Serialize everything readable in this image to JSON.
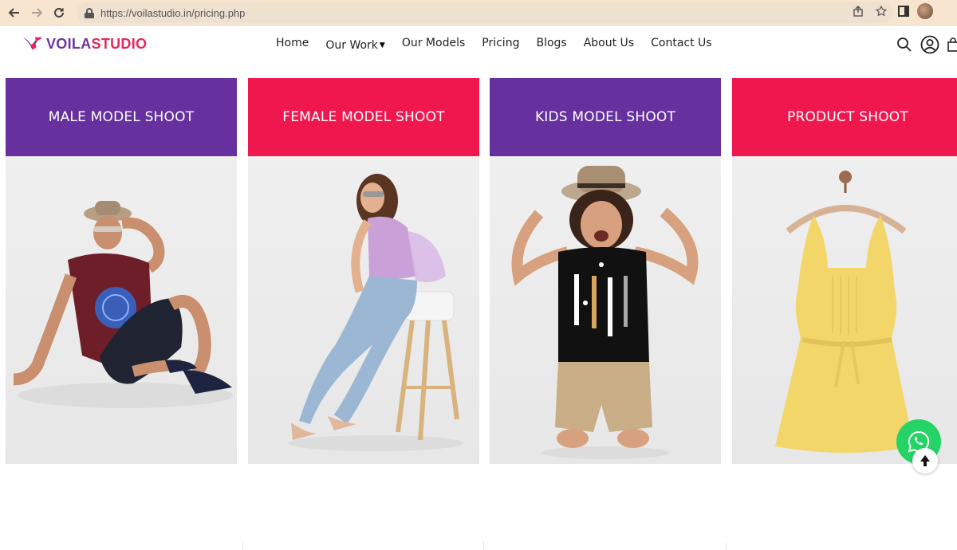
{
  "browser": {
    "url": "https://voilastudio.in/pricing.php",
    "back_icon": "arrow-left-icon",
    "forward_icon": "arrow-right-icon",
    "reload_icon": "reload-icon"
  },
  "site": {
    "logo": {
      "part1": "VOILA",
      "part2": "STUDIO",
      "color1": "#6b35a0",
      "color2": "#e8265a"
    },
    "nav": [
      {
        "label": "Home"
      },
      {
        "label": "Our Work"
      },
      {
        "label": "Our Models"
      },
      {
        "label": "Pricing"
      },
      {
        "label": "Blogs"
      },
      {
        "label": "About Us"
      },
      {
        "label": "Contact Us"
      }
    ]
  },
  "cards": [
    {
      "title": "MALE MODEL SHOOT",
      "color": "#66309e"
    },
    {
      "title": "FEMALE MODEL SHOOT",
      "color": "#f0174f"
    },
    {
      "title": "KIDS MODEL SHOOT",
      "color": "#66309e"
    },
    {
      "title": "PRODUCT SHOOT",
      "color": "#f0174f"
    }
  ],
  "colors": {
    "whatsapp": "#25d366",
    "chrome_bg": "#f7e5d0"
  }
}
